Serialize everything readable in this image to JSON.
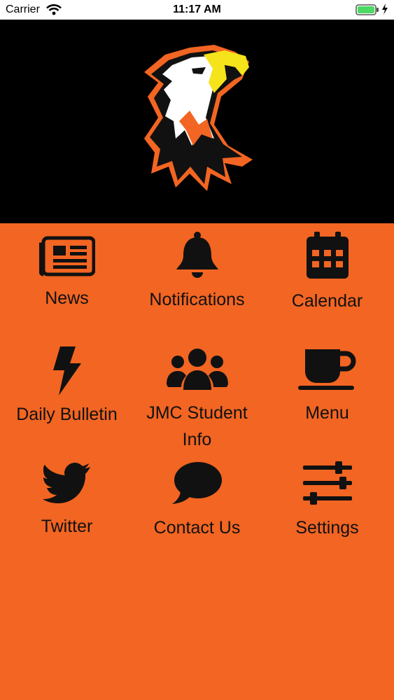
{
  "status_bar": {
    "carrier": "Carrier",
    "time": "11:17 AM",
    "battery_color": "#4cd964"
  },
  "header": {
    "background": "#000000",
    "logo_icon": "eagle-mascot"
  },
  "theme": {
    "accent": "#f26522",
    "icon_color": "#111111"
  },
  "menu": {
    "items": [
      {
        "label": "News",
        "icon": "newspaper-icon"
      },
      {
        "label": "Notifications",
        "icon": "bell-icon"
      },
      {
        "label": "Calendar",
        "icon": "calendar-icon"
      },
      {
        "label": "Daily Bulletin",
        "icon": "lightning-bolt-icon"
      },
      {
        "label": "JMC Student Info",
        "icon": "users-group-icon"
      },
      {
        "label": "Menu",
        "icon": "coffee-cup-icon"
      },
      {
        "label": "Twitter",
        "icon": "twitter-bird-icon"
      },
      {
        "label": "Contact Us",
        "icon": "speech-bubble-icon"
      },
      {
        "label": "Settings",
        "icon": "sliders-icon"
      }
    ]
  }
}
